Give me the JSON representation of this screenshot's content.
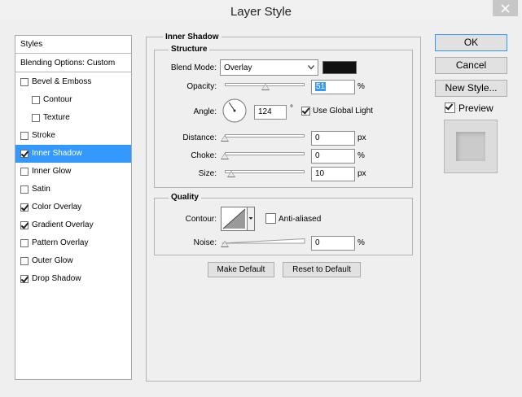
{
  "window": {
    "title": "Layer Style"
  },
  "sidebar": {
    "header": "Styles",
    "blending": "Blending Options: Custom",
    "items": [
      {
        "label": "Bevel & Emboss",
        "checked": false
      },
      {
        "label": "Contour",
        "checked": false
      },
      {
        "label": "Texture",
        "checked": false
      },
      {
        "label": "Stroke",
        "checked": false
      },
      {
        "label": "Inner Shadow",
        "checked": true
      },
      {
        "label": "Inner Glow",
        "checked": false
      },
      {
        "label": "Satin",
        "checked": false
      },
      {
        "label": "Color Overlay",
        "checked": true
      },
      {
        "label": "Gradient Overlay",
        "checked": true
      },
      {
        "label": "Pattern Overlay",
        "checked": false
      },
      {
        "label": "Outer Glow",
        "checked": false
      },
      {
        "label": "Drop Shadow",
        "checked": true
      }
    ],
    "selected_item": "Inner Shadow",
    "selected_color": "#3399ff"
  },
  "panel": {
    "title": "Inner Shadow",
    "structure": {
      "title": "Structure",
      "blend_mode_label": "Blend Mode:",
      "blend_mode_value": "Overlay",
      "swatch_color": "#111111",
      "opacity_label": "Opacity:",
      "opacity_value": "51",
      "opacity_unit": "%",
      "opacity_fraction": 0.51,
      "angle_label": "Angle:",
      "angle_value": "124",
      "angle_degrees": 124,
      "angle_unit": "°",
      "use_global_light_label": "Use Global Light",
      "use_global_light": true,
      "distance_label": "Distance:",
      "distance_value": "0",
      "distance_unit": "px",
      "distance_fraction": 0,
      "choke_label": "Choke:",
      "choke_value": "0",
      "choke_unit": "%",
      "choke_fraction": 0,
      "size_label": "Size:",
      "size_value": "10",
      "size_unit": "px",
      "size_fraction": 0.08
    },
    "quality": {
      "title": "Quality",
      "contour_label": "Contour:",
      "anti_aliased_label": "Anti-aliased",
      "anti_aliased": false,
      "noise_label": "Noise:",
      "noise_value": "0",
      "noise_unit": "%",
      "noise_fraction": 0
    },
    "make_default_label": "Make Default",
    "reset_default_label": "Reset to Default"
  },
  "actions": {
    "ok_label": "OK",
    "cancel_label": "Cancel",
    "new_style_label": "New Style...",
    "preview_label": "Preview",
    "preview_checked": true
  }
}
